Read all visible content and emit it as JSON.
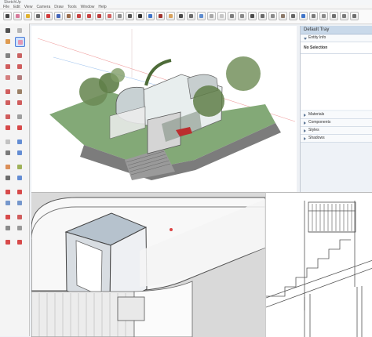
{
  "window": {
    "title": "SketchUp",
    "menus": [
      "File",
      "Edit",
      "View",
      "Camera",
      "Draw",
      "Tools",
      "Window",
      "Help"
    ]
  },
  "toolbar": {
    "top_icons": [
      "select-icon",
      "eraser-icon",
      "paint-icon",
      "line-icon",
      "arc-icon",
      "rectangle-icon",
      "push-pull-icon",
      "move-icon",
      "rotate-icon",
      "scale-icon",
      "offset-icon",
      "tape-icon",
      "dimension-icon",
      "text-icon",
      "axes-icon",
      "orbit-icon",
      "pan-icon",
      "zoom-icon",
      "zoom-extents-icon",
      "section-icon",
      "shadow-icon",
      "fog-icon",
      "xray-icon",
      "back-edges-icon",
      "wireframe-icon",
      "hidden-line-icon",
      "shaded-icon",
      "textured-icon",
      "monochrome-icon",
      "front-view-icon",
      "top-view-icon",
      "iso-view-icon",
      "right-view-icon",
      "back-view-icon",
      "left-view-icon"
    ]
  },
  "colors": {
    "accent": "#c94242",
    "tray_header": "#c9d9ea",
    "canvas": "#ffffff",
    "ground_green": "#83a977",
    "stair_gray": "#8c8c8c"
  },
  "tray": {
    "title": "Default Tray",
    "entity_info": "Entity Info",
    "selection": "No Selection",
    "sections": [
      "Materials",
      "Components",
      "Styles",
      "Shadows"
    ]
  }
}
